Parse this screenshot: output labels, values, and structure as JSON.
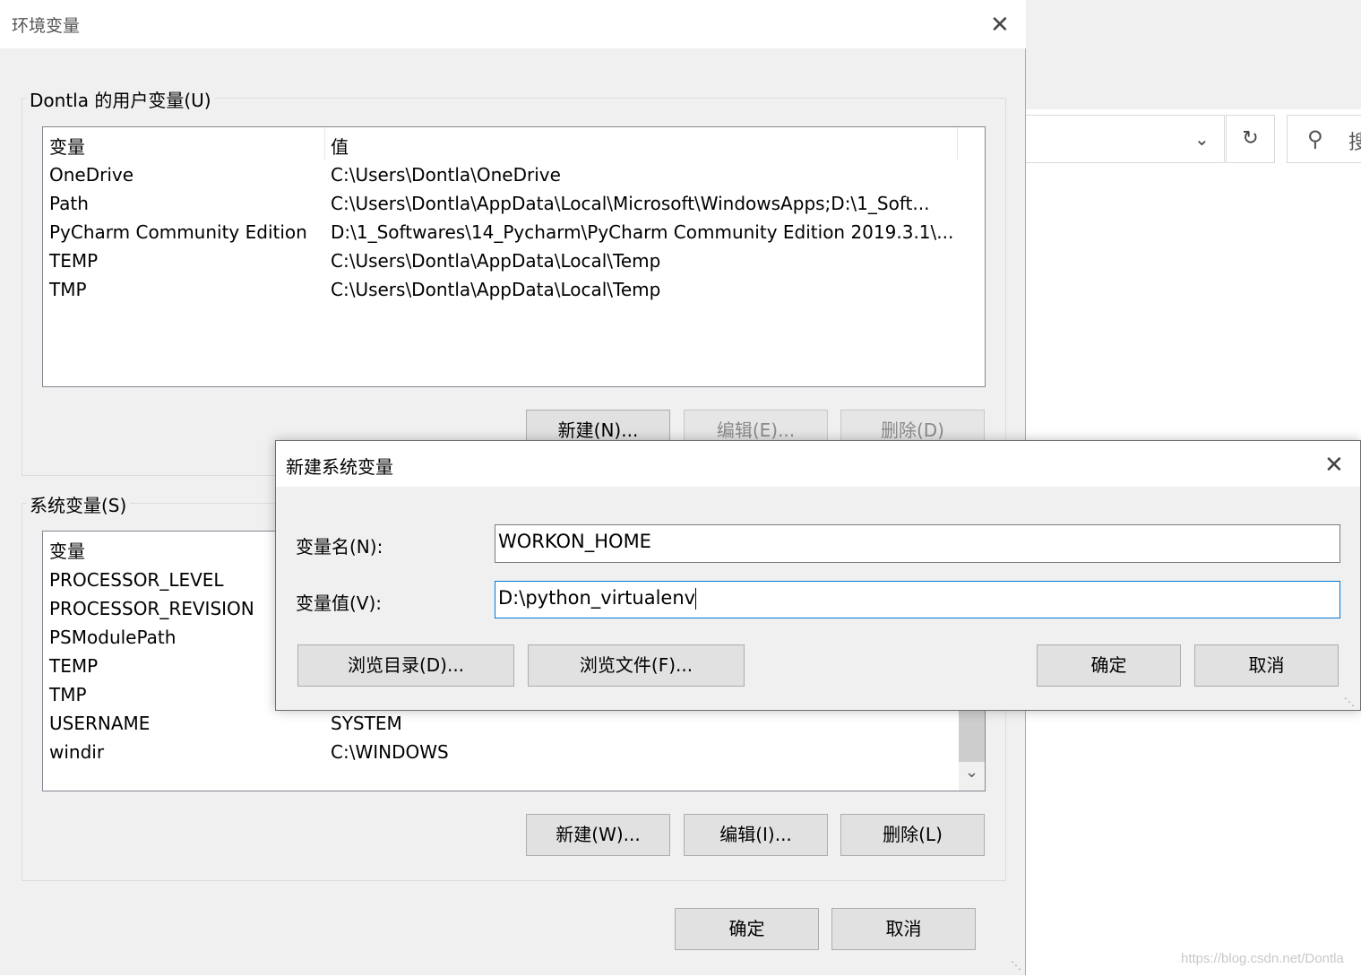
{
  "background": {
    "search_glyph": "搜",
    "watermark": "https://blog.csdn.net/Dontla"
  },
  "env_dialog": {
    "title": "环境变量",
    "user_group": {
      "label": "Dontla 的用户变量(U)",
      "col_var": "变量",
      "col_val": "值",
      "rows": [
        {
          "name": "OneDrive",
          "value": "C:\\Users\\Dontla\\OneDrive"
        },
        {
          "name": "Path",
          "value": "C:\\Users\\Dontla\\AppData\\Local\\Microsoft\\WindowsApps;D:\\1_Soft..."
        },
        {
          "name": "PyCharm Community Edition",
          "value": "D:\\1_Softwares\\14_Pycharm\\PyCharm Community Edition 2019.3.1\\..."
        },
        {
          "name": "TEMP",
          "value": "C:\\Users\\Dontla\\AppData\\Local\\Temp"
        },
        {
          "name": "TMP",
          "value": "C:\\Users\\Dontla\\AppData\\Local\\Temp"
        }
      ],
      "btn_new": "新建(N)...",
      "btn_edit": "编辑(E)...",
      "btn_delete": "删除(D)"
    },
    "system_group": {
      "label": "系统变量(S)",
      "col_var": "变量",
      "rows": [
        {
          "name": "PROCESSOR_LEVEL",
          "value": ""
        },
        {
          "name": "PROCESSOR_REVISION",
          "value": ""
        },
        {
          "name": "PSModulePath",
          "value": ""
        },
        {
          "name": "TEMP",
          "value": ""
        },
        {
          "name": "TMP",
          "value": ""
        },
        {
          "name": "USERNAME",
          "value": "SYSTEM"
        },
        {
          "name": "windir",
          "value": "C:\\WINDOWS"
        }
      ],
      "btn_new": "新建(W)...",
      "btn_edit": "编辑(I)...",
      "btn_delete": "删除(L)"
    },
    "btn_ok": "确定",
    "btn_cancel": "取消"
  },
  "new_var_dialog": {
    "title": "新建系统变量",
    "name_label": "变量名(N):",
    "name_value": "WORKON_HOME",
    "value_label": "变量值(V):",
    "value_value": "D:\\python_virtualenv",
    "btn_browse_dir": "浏览目录(D)...",
    "btn_browse_file": "浏览文件(F)...",
    "btn_ok": "确定",
    "btn_cancel": "取消"
  }
}
